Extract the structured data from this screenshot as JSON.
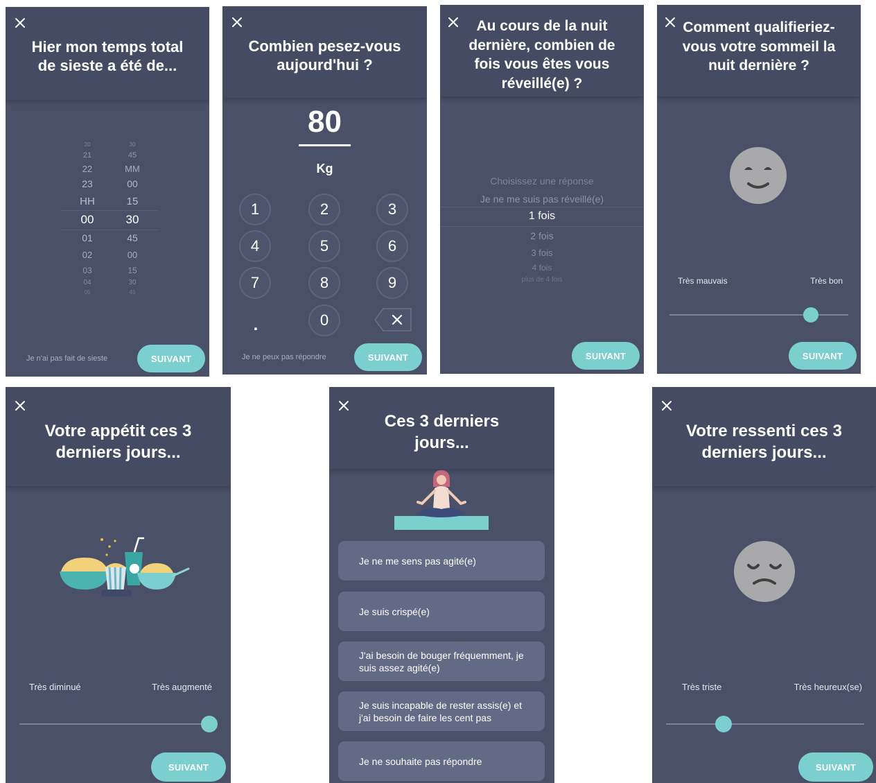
{
  "screens": {
    "nap": {
      "title": "Hier mon temps total de sieste a été de...",
      "hours": [
        "20",
        "21",
        "22",
        "23",
        "HH",
        "00",
        "01",
        "02",
        "03",
        "04",
        "05"
      ],
      "minutes": [
        "30",
        "45",
        "MM",
        "00",
        "15",
        "30",
        "45",
        "00",
        "15",
        "30",
        "45"
      ],
      "selected_hours": "00",
      "selected_minutes": "30",
      "skip_label": "Je n'ai pas fait de sieste",
      "next_label": "SUIVANT"
    },
    "weight": {
      "title": "Combien pesez-vous aujourd'hui ?",
      "value": "80",
      "unit": "Kg",
      "keys": [
        "1",
        "2",
        "3",
        "4",
        "5",
        "6",
        "7",
        "8",
        "9"
      ],
      "dot_key": ".",
      "zero_key": "0",
      "skip_label": "Je ne peux pas répondre",
      "next_label": "SUIVANT"
    },
    "wakeups": {
      "title": "Au cours de la nuit dernière, combien de fois vous êtes vous réveillé(e) ?",
      "options": [
        "Choisissez une réponse",
        "Je ne me suis pas réveillé(e)",
        "1 fois",
        "2 fois",
        "3 fois",
        "4 fois",
        "plus de 4 fois"
      ],
      "selected": "1 fois",
      "next_label": "SUIVANT"
    },
    "sleep_quality": {
      "title": "Comment qualifieriez-vous votre sommeil la nuit dernière ?",
      "min_label": "Très mauvais",
      "max_label": "Très bon",
      "slider_value": 0.8,
      "face": "content-face-icon",
      "next_label": "SUIVANT"
    },
    "appetite": {
      "title": "Votre appétit ces 3 derniers jours...",
      "min_label": "Très diminué",
      "max_label": "Très augmenté",
      "slider_value": 1.0,
      "illustration": "food-bowls-icon",
      "next_label": "SUIVANT"
    },
    "agitation": {
      "title": "Ces 3 derniers jours...",
      "illustration": "meditation-icon",
      "choices": [
        "Je ne me sens pas agité(e)",
        "Je suis crispé(e)",
        "J'ai besoin de bouger fréquemment, je suis assez agité(e)",
        "Je suis incapable de rester assis(e) et j'ai besoin de faire les cent pas",
        "Je ne souhaite pas répondre"
      ]
    },
    "mood": {
      "title": "Votre ressenti ces 3 derniers jours...",
      "min_label": "Très triste",
      "max_label": "Très heureux(se)",
      "slider_value": 0.28,
      "face": "sad-face-icon",
      "next_label": "SUIVANT"
    }
  },
  "colors": {
    "background": "#4a5068",
    "header": "#454b62",
    "accent": "#7ccfcf",
    "choice": "#636a85"
  }
}
